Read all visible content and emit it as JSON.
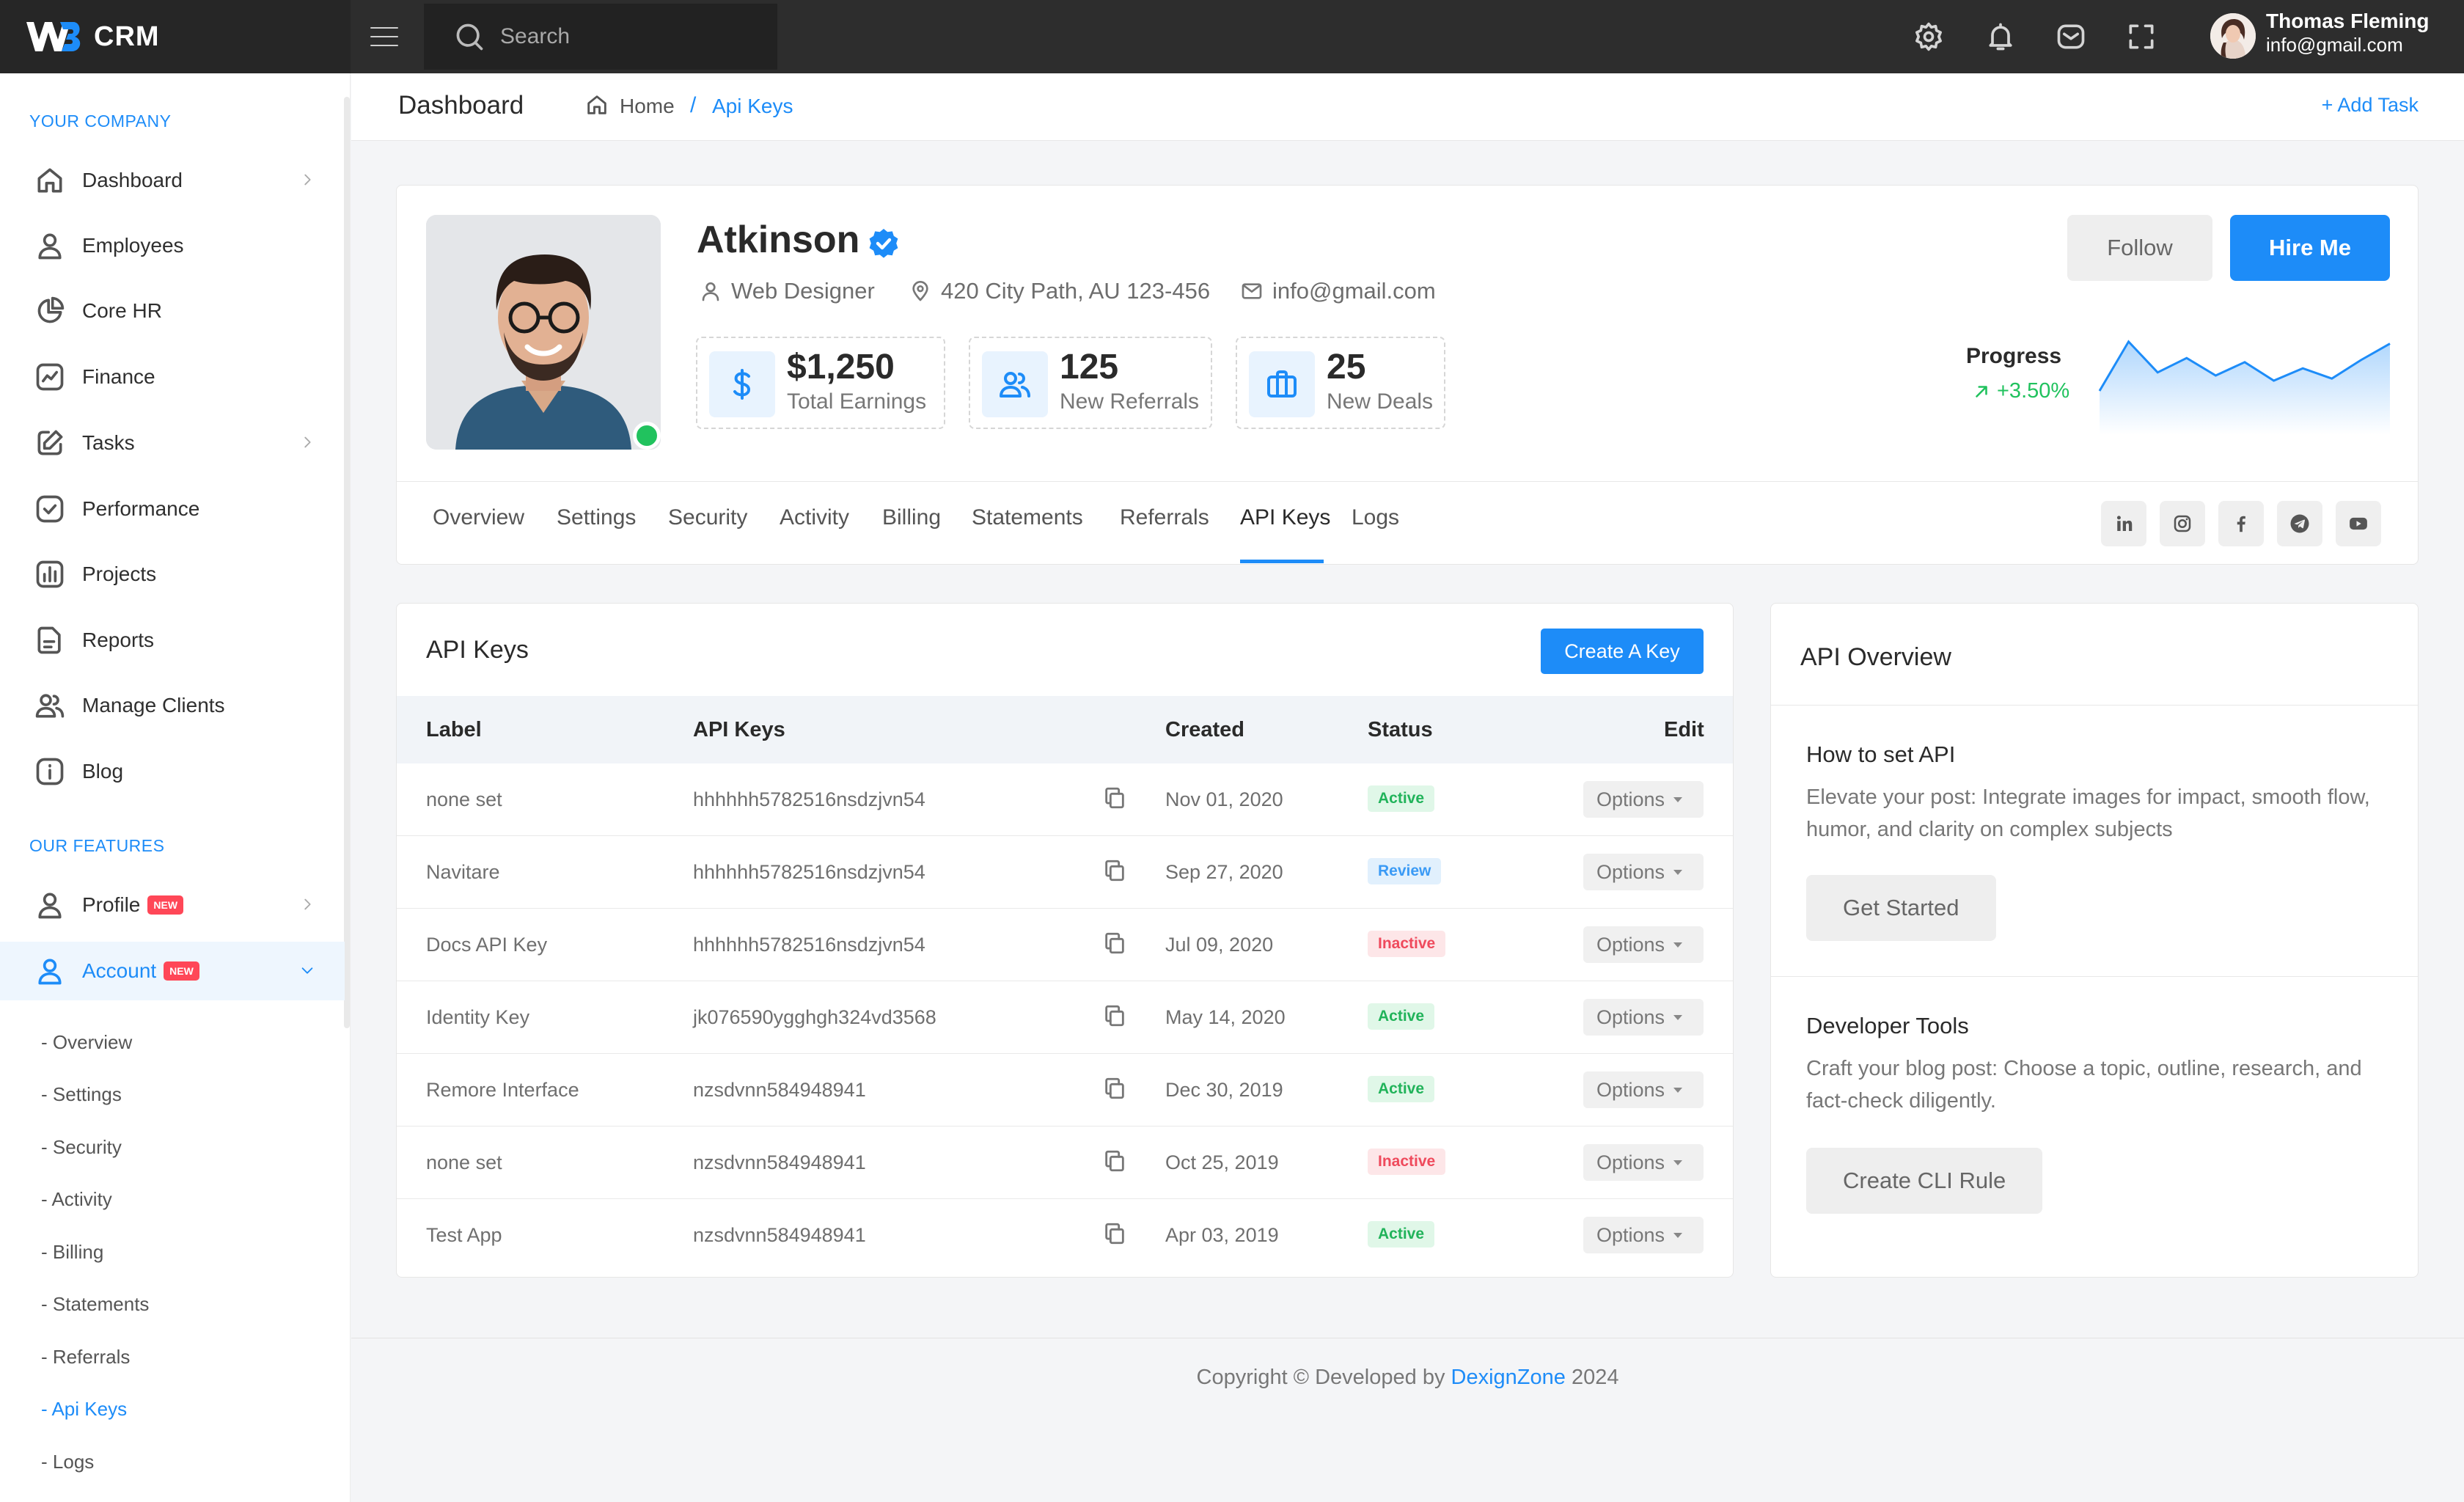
{
  "app": {
    "brand": "CRM",
    "brand_color": "#1d8cf8"
  },
  "topbar": {
    "search_placeholder": "Search",
    "icons": [
      "menu-icon",
      "search-icon",
      "settings-icon",
      "bell-icon",
      "mail-icon",
      "fullscreen-icon"
    ],
    "user": {
      "name": "Thomas Fleming",
      "email": "info@gmail.com"
    }
  },
  "sidebar": {
    "section1": "YOUR COMPANY",
    "items": [
      {
        "label": "Dashboard",
        "icon": "home-icon"
      },
      {
        "label": "Employees",
        "icon": "user-icon"
      },
      {
        "label": "Core HR",
        "icon": "pie-chart-icon"
      },
      {
        "label": "Finance",
        "icon": "chart-line-icon"
      },
      {
        "label": "Tasks",
        "icon": "edit-icon"
      },
      {
        "label": "Performance",
        "icon": "check-square-icon"
      },
      {
        "label": "Projects",
        "icon": "bar-chart-icon"
      },
      {
        "label": "Reports",
        "icon": "file-icon"
      },
      {
        "label": "Manage Clients",
        "icon": "users-icon"
      },
      {
        "label": "Blog",
        "icon": "info-icon"
      }
    ],
    "section2": "OUR FEATURES",
    "features": [
      {
        "label": "Profile",
        "badge": "NEW"
      },
      {
        "label": "Account",
        "badge": "NEW"
      }
    ],
    "sub_items": [
      "Overview",
      "Settings",
      "Security",
      "Activity",
      "Billing",
      "Statements",
      "Referrals",
      "Api Keys",
      "Logs"
    ],
    "sub_prefix": "-"
  },
  "breadcrumb": {
    "title": "Dashboard",
    "home": "Home",
    "separator": "/",
    "current": "Api Keys",
    "add_task": "+ Add Task"
  },
  "profile": {
    "name": "Atkinson",
    "role": "Web Designer",
    "address": "420 City Path, AU 123-456",
    "email": "info@gmail.com",
    "stats": [
      {
        "value": "$1,250",
        "label": "Total Earnings",
        "icon": "dollar-icon"
      },
      {
        "value": "125",
        "label": "New Referrals",
        "icon": "users-icon"
      },
      {
        "value": "25",
        "label": "New Deals",
        "icon": "briefcase-icon"
      }
    ],
    "follow_label": "Follow",
    "hire_label": "Hire Me",
    "progress_label": "Progress",
    "progress_value": "+3.50%",
    "sparkline": [
      40,
      88,
      58,
      72,
      55,
      68,
      50,
      62,
      52,
      70,
      86
    ],
    "tabs": [
      "Overview",
      "Settings",
      "Security",
      "Activity",
      "Billing",
      "Statements",
      "Referrals",
      "API Keys",
      "Logs"
    ],
    "active_tab": "API Keys",
    "social": [
      "linkedin-icon",
      "instagram-icon",
      "facebook-icon",
      "telegram-icon",
      "youtube-icon"
    ]
  },
  "api_keys": {
    "title": "API Keys",
    "create_label": "Create A Key",
    "columns": [
      "Label",
      "API Keys",
      "Created",
      "Status",
      "Edit"
    ],
    "option_label": "Options",
    "rows": [
      {
        "label": "none set",
        "key": "hhhhhh5782516nsdzjvn54",
        "created": "Nov 01, 2020",
        "status": "Active"
      },
      {
        "label": "Navitare",
        "key": "hhhhhh5782516nsdzjvn54",
        "created": "Sep 27, 2020",
        "status": "Review"
      },
      {
        "label": "Docs API Key",
        "key": "hhhhhh5782516nsdzjvn54",
        "created": "Jul 09, 2020",
        "status": "Inactive"
      },
      {
        "label": "Identity Key",
        "key": "jk076590ygghgh324vd3568",
        "created": "May 14, 2020",
        "status": "Active"
      },
      {
        "label": "Remore Interface",
        "key": "nzsdvnn584948941",
        "created": "Dec 30, 2019",
        "status": "Active"
      },
      {
        "label": "none set",
        "key": "nzsdvnn584948941",
        "created": "Oct 25, 2019",
        "status": "Inactive"
      },
      {
        "label": "Test App",
        "key": "nzsdvnn584948941",
        "created": "Apr 03, 2019",
        "status": "Active"
      }
    ]
  },
  "overview": {
    "title": "API Overview",
    "sections": [
      {
        "heading": "How to set API",
        "text": "Elevate your post: Integrate images for impact, smooth flow, humor, and clarity on complex subjects",
        "button": "Get Started"
      },
      {
        "heading": "Developer Tools",
        "text": "Craft your blog post: Choose a topic, outline, research, and fact-check diligently.",
        "button": "Create CLI Rule"
      }
    ]
  },
  "footer": {
    "prefix": "Copyright © Developed by",
    "company": "DexignZone",
    "year": "2024"
  }
}
